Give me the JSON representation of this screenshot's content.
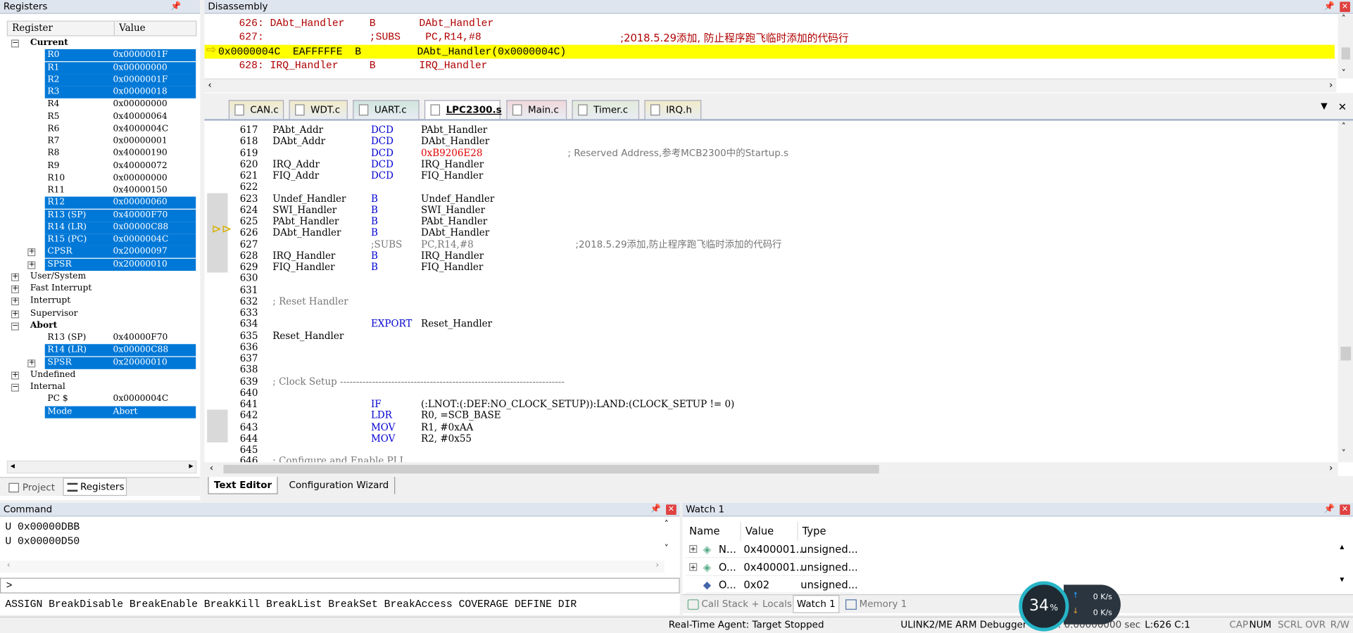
{
  "registers": {
    "title": "Registers",
    "col_register": "Register",
    "col_value": "Value",
    "group_current": "Current",
    "current": [
      [
        "R0",
        "0x0000001F",
        true
      ],
      [
        "R1",
        "0x00000000",
        true
      ],
      [
        "R2",
        "0x0000001F",
        true
      ],
      [
        "R3",
        "0x00000018",
        true
      ],
      [
        "R4",
        "0x00000000",
        false
      ],
      [
        "R5",
        "0x40000064",
        false
      ],
      [
        "R6",
        "0x4000004C",
        false
      ],
      [
        "R7",
        "0x00000001",
        false
      ],
      [
        "R8",
        "0x40000190",
        false
      ],
      [
        "R9",
        "0x40000072",
        false
      ],
      [
        "R10",
        "0x00000000",
        false
      ],
      [
        "R11",
        "0x40000150",
        false
      ],
      [
        "R12",
        "0x00000060",
        true
      ],
      [
        "R13 (SP)",
        "0x40000F70",
        true
      ],
      [
        "R14 (LR)",
        "0x00000C88",
        true
      ],
      [
        "R15 (PC)",
        "0x0000004C",
        true
      ],
      [
        "CPSR",
        "0x20000097",
        true
      ],
      [
        "SPSR",
        "0x20000010",
        true
      ]
    ],
    "groups": [
      "User/System",
      "Fast Interrupt",
      "Interrupt",
      "Supervisor"
    ],
    "group_abort": "Abort",
    "abort": [
      [
        "R13 (SP)",
        "0x40000F70",
        false
      ],
      [
        "R14 (LR)",
        "0x00000C88",
        true
      ],
      [
        "SPSR",
        "0x20000010",
        true
      ]
    ],
    "group_undefined": "Undefined",
    "group_internal": "Internal",
    "internal": [
      [
        "PC  $",
        "0x0000004C",
        false
      ],
      [
        "Mode",
        "Abort",
        true
      ]
    ],
    "tab_project": "Project",
    "tab_registers": "Registers"
  },
  "disasm": {
    "title": "Disassembly",
    "l1": "626: DAbt_Handler    B       DAbt_Handler",
    "l2": "627:                 ;SUBS    PC,R14,#8",
    "l2c": ";2018.5.29添加, 防止程序跑飞临时添加的代码行",
    "l3": "0x0000004C  EAFFFFFE  B         DAbt_Handler(0x0000004C)",
    "l4": "628: IRQ_Handler     B       IRQ_Handler"
  },
  "tabs": [
    "CAN.c",
    "WDT.c",
    "UART.c",
    "LPC2300.s",
    "Main.c",
    "Timer.c",
    "IRQ.h"
  ],
  "editor": {
    "lines": [
      [
        "617",
        "PAbt_Addr",
        "DCD",
        "PAbt_Handler",
        ""
      ],
      [
        "618",
        "DAbt_Addr",
        "DCD",
        "DAbt_Handler",
        ""
      ],
      [
        "619",
        "",
        "DCD",
        "0xB9206E28",
        "; Reserved Address,参考MCB2300中的Startup.s"
      ],
      [
        "620",
        "IRQ_Addr",
        "DCD",
        "IRQ_Handler",
        ""
      ],
      [
        "621",
        "FIQ_Addr",
        "DCD",
        "FIQ_Handler",
        ""
      ],
      [
        "622",
        "",
        "",
        "",
        ""
      ],
      [
        "623",
        "Undef_Handler",
        "B",
        "Undef_Handler",
        ""
      ],
      [
        "624",
        "SWI_Handler",
        "B",
        "SWI_Handler",
        ""
      ],
      [
        "625",
        "PAbt_Handler",
        "B",
        "PAbt_Handler",
        ""
      ],
      [
        "626",
        "DAbt_Handler",
        "B",
        "DAbt_Handler",
        ""
      ],
      [
        "627",
        "",
        ";SUBS",
        "PC,R14,#8",
        ";2018.5.29添加,防止程序跑飞临时添加的代码行"
      ],
      [
        "628",
        "IRQ_Handler",
        "B",
        "IRQ_Handler",
        ""
      ],
      [
        "629",
        "FIQ_Handler",
        "B",
        "FIQ_Handler",
        ""
      ],
      [
        "630",
        "",
        "",
        "",
        ""
      ],
      [
        "631",
        "",
        "",
        "",
        ""
      ],
      [
        "632",
        "; Reset Handler",
        "",
        "",
        ""
      ],
      [
        "633",
        "",
        "",
        "",
        ""
      ],
      [
        "634",
        "",
        "EXPORT",
        "Reset_Handler",
        ""
      ],
      [
        "635",
        "Reset_Handler",
        "",
        "",
        ""
      ],
      [
        "636",
        "",
        "",
        "",
        ""
      ],
      [
        "637",
        "",
        "",
        "",
        ""
      ],
      [
        "638",
        "",
        "",
        "",
        ""
      ],
      [
        "639",
        "; Clock Setup ----------------------------------------------------------------------",
        "",
        "",
        ""
      ],
      [
        "640",
        "",
        "",
        "",
        ""
      ],
      [
        "641",
        "",
        "IF",
        "(:LNOT:(:DEF:NO_CLOCK_SETUP)):LAND:(CLOCK_SETUP != 0)",
        ""
      ],
      [
        "642",
        "",
        "LDR",
        "R0, =SCB_BASE",
        ""
      ],
      [
        "643",
        "",
        "MOV",
        "R1, #0xAA",
        ""
      ],
      [
        "644",
        "",
        "MOV",
        "R2, #0x55",
        ""
      ],
      [
        "645",
        "",
        "",
        "",
        ""
      ],
      [
        "646",
        "; Configure and Enable PLL",
        "",
        "",
        ""
      ]
    ],
    "bottom_tab_editor": "Text Editor",
    "bottom_tab_wizard": "Configuration Wizard"
  },
  "command": {
    "title": "Command",
    "l1": "U 0x00000DBB",
    "l2": "U 0x00000D50",
    "prompt": ">",
    "hints": "ASSIGN BreakDisable BreakEnable BreakKill BreakList BreakSet BreakAccess COVERAGE DEFINE DIR"
  },
  "watch": {
    "title": "Watch 1",
    "col_name": "Name",
    "col_value": "Value",
    "col_type": "Type",
    "rows": [
      [
        "N...",
        "0x400001...",
        "unsigned..."
      ],
      [
        "O...",
        "0x400001...",
        "unsigned..."
      ],
      [
        "O...",
        "0x02",
        "unsigned..."
      ]
    ],
    "tab_callstack": "Call Stack + Locals",
    "tab_watch": "Watch 1",
    "tab_memory": "Memory 1"
  },
  "net": {
    "percent": "34",
    "percent_unit": "%",
    "up": "0 K/s",
    "down": "0 K/s"
  },
  "status": {
    "agent": "Real-Time Agent: Target Stopped",
    "debugger": "ULINK2/ME ARM Debugger",
    "time": "t1: 0.00000000 sec",
    "pos": "L:626 C:1",
    "caps": "CAP",
    "num": "NUM",
    "scrl": "SCRL",
    "ovr": "OVR",
    "rw": "R/W"
  }
}
